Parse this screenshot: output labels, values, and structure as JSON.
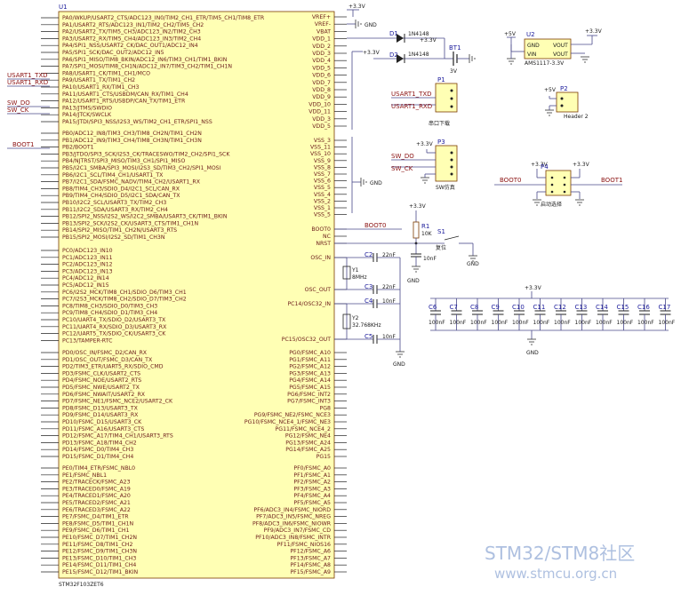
{
  "chip": {
    "designator": "U1",
    "part": "STM32F103ZET6",
    "left_group1": [
      "PA0/WKUP/USART2_CTS/ADC123_IN0/TIM2_CH1_ETR/TIM5_CH1/TIM8_ETR",
      "PA1/USART2_RTS/ADC123_IN1/TIM2_CH2/TIM5_CH2",
      "PA2/USART2_TX/TIM5_CH3/ADC123_IN2/TIM2_CH3",
      "PA3/USART2_RX/TIM5_CH4/ADC123_IN3/TIM2_CH4",
      "PA4/SPI1_NSS/USART2_CK/DAC_OUT1/ADC12_IN4",
      "PA5/SPI1_SCK/DAC_OUT2/ADC12_IN5",
      "PA6/SPI1_MISO/TIM8_BKIN/ADC12_IN6/TIM3_CH1/TIM1_BKIN",
      "PA7/SPI1_MOSI/TIM8_CH1N/ADC12_IN7/TIM3_CH2/TIM1_CH1N",
      "PA8/USART1_CK/TIM1_CH1/MCO",
      "PA9/USART1_TX/TIM1_CH2",
      "PA10/USART1_RX/TIM1_CH3",
      "PA11/USART1_CTS/USBDM/CAN_RX/TIM1_CH4",
      "PA12/USART1_RTS/USBDP/CAN_TX/TIM1_ETR",
      "PA13/JTMS/SWDIO",
      "PA14/JTCK/SWCLK",
      "PA15/JTDI/SPI3_NSS/I2S3_WS/TIM2_CH1_ETR/SPI1_NSS"
    ],
    "left_group2": [
      "PB0/ADC12_IN8/TIM3_CH3/TIM8_CH2N/TIM1_CH2N",
      "PB1/ADC12_IN9/TIM3_CH4/TIM8_CH3N/TIM1_CH3N",
      "PB2/BOOT1",
      "PB3/JTDO/SPI3_SCK/I2S3_CK/TRACESWO/TIM2_CH2/SPI1_SCK",
      "PB4/NJTRST/SPI3_MISO/TIM3_CH1/SPI1_MISO",
      "PB5/I2C1_SMBA/SPI3_MOSI/I2S3_SD/TIM3_CH2/SPI1_MOSI",
      "PB6/I2C1_SCL/TIM4_CH1/USART1_TX",
      "PB7/I2C1_SDA/FSMC_NADV/TIM4_CH2/USART1_RX",
      "PB8/TIM4_CH3/SDIO_D4/I2C1_SCL/CAN_RX",
      "PB9/TIM4_CH4/SDIO_D5/I2C1_SDA/CAN_TX",
      "PB10/I2C2_SCL/USART3_TX/TIM2_CH3",
      "PB11/I2C2_SDA/USART3_RX/TIM2_CH4",
      "PB12/SPI2_NSS/I2S2_WS/I2C2_SMBA/USART3_CK/TIM1_BKIN",
      "PB13/SPI2_SCK/I2S2_CK/USART3_CTS/TIM1_CH1N",
      "PB14/SPI2_MISO/TIM1_CH2N/USART3_RTS",
      "PB15/SPI2_MOSI/I2S2_SD/TIM1_CH3N"
    ],
    "left_group3": [
      "PC0/ADC123_IN10",
      "PC1/ADC123_IN11",
      "PC2/ADC123_IN12",
      "PC3/ADC123_IN13",
      "PC4/ADC12_IN14",
      "PC5/ADC12_IN15",
      "PC6/I2S2_MCK/TIM8_CH1/SDIO_D6/TIM3_CH1",
      "PC7/I2S3_MCK/TIM8_CH2/SDIO_D7/TIM3_CH2",
      "PC8/TIM8_CH3/SDIO_D0/TIM3_CH3",
      "PC9/TIM8_CH4/SDIO_D1/TIM3_CH4",
      "PC10/UART4_TX/SDIO_D2/USART3_TX",
      "PC11/UART4_RX/SDIO_D3/USART3_RX",
      "PC12/UART5_TX/SDIO_CK/USART3_CK",
      "PC13/TAMPER-RTC"
    ],
    "left_group4": [
      "PD0/OSC_IN/FSMC_D2/CAN_RX",
      "PD1/OSC_OUT/FSMC_D3/CAN_TX",
      "PD2/TIM3_ETR/UART5_RX/SDIO_CMD",
      "PD3/FSMC_CLK/USART2_CTS",
      "PD4/FSMC_NOE/USART2_RTS",
      "PD5/FSMC_NWE/USART2_TX",
      "PD6/FSMC_NWAIT/USART2_RX",
      "PD7/FSMC_NE1/FSMC_NCE2/USART2_CK",
      "PD8/FSMC_D13/USART3_TX",
      "PD9/FSMC_D14/USART3_RX",
      "PD10/FSMC_D15/USART3_CK",
      "PD11/FSMC_A16/USART3_CTS",
      "PD12/FSMC_A17/TIM4_CH1/USART3_RTS",
      "PD13/FSMC_A18/TIM4_CH2",
      "PD14/FSMC_D0/TIM4_CH3",
      "PD15/FSMC_D1/TIM4_CH4"
    ],
    "left_group5": [
      "PE0/TIM4_ETR/FSMC_NBL0",
      "PE1/FSMC_NBL1",
      "PE2/TRACECK/FSMC_A23",
      "PE3/TRACED0/FSMC_A19",
      "PE4/TRACED1/FSMC_A20",
      "PE5/TRACED2/FSMC_A21",
      "PE6/TRACED3/FSMC_A22",
      "PE7/FSMC_D4/TIM1_ETR",
      "PE8/FSMC_D5/TIM1_CH1N",
      "PE9/FSMC_D6/TIM1_CH1",
      "PE10/FSMC_D7/TIM1_CH2N",
      "PE11/FSMC_D8/TIM1_CH2",
      "PE12/FSMC_D9/TIM1_CH3N",
      "PE13/FSMC_D10/TIM1_CH3",
      "PE14/FSMC_D11/TIM1_CH4",
      "PE15/FSMC_D12/TIM1_BKIN"
    ],
    "right_power": [
      "VREF+",
      "VREF-",
      "VBAT",
      "VDD_1",
      "VDD_2",
      "VDD_3",
      "VDD_4",
      "VDD_5",
      "VDD_6",
      "VDD_7",
      "VDD_8",
      "VDD_9",
      "VDD_10",
      "VDD_11",
      "VDD_3",
      "VDD_5"
    ],
    "right_vss": [
      "VSS_3",
      "VSS_11",
      "VSS_10",
      "VSS_9",
      "VSS_8",
      "VSS_7",
      "VSS_6",
      "VSS_5",
      "VSS_4",
      "VSS_2",
      "VSS_1",
      "VSS_5"
    ],
    "right_ctrl": [
      "BOOT0",
      "NC",
      "NRST",
      "OSC_IN",
      "OSC_OUT",
      "PC14/OSC32_IN",
      "PC15/OSC32_OUT"
    ],
    "right_pg": [
      "PG0/FSMC_A10",
      "PG1/FSMC_A11",
      "PG2/FSMC_A12",
      "PG3/FSMC_A13",
      "PG4/FSMC_A14",
      "PG5/FSMC_A15",
      "PG6/FSMC_INT2",
      "PG7/FSMC_INT3",
      "PG8",
      "PG9/FSMC_NE2/FSMC_NCE3",
      "PG10/FSMC_NCE4_1/FSMC_NE3",
      "PG11/FSMC_NCE4_2",
      "PG12/FSMC_NE4",
      "PG13/FSMC_A24",
      "PG14/FSMC_A25",
      "PG15"
    ],
    "right_pf": [
      "PF0/FSMC_A0",
      "PF1/FSMC_A1",
      "PF2/FSMC_A2",
      "PF3/FSMC_A3",
      "PF4/FSMC_A4",
      "PF5/FSMC_A5",
      "PF6/ADC3_IN4/FSMC_NIORD",
      "PF7/ADC3_IN5/FSMC_NREG",
      "PF8/ADC3_IN6/FSMC_NIOWR",
      "PF9/ADC3_IN7/FSMC_CD",
      "PF10/ADC3_IN8/FSMC_INTR",
      "PF11/FSMC_NIOS16",
      "PF12/FSMC_A6",
      "PF13/FSMC_A7",
      "PF14/FSMC_A8",
      "PF15/FSMC_A9"
    ]
  },
  "nets": {
    "usart1_txd": "USART1_TXD",
    "usart1_rxd": "USART1_RXD",
    "sw_do": "SW_DO",
    "sw_ck": "SW_CK",
    "boot1": "BOOT1",
    "boot0": "BOOT0",
    "gnd": "GND",
    "v33": "+3.3V",
    "v5": "+5V"
  },
  "diodes": {
    "d1": "D1",
    "d2": "D2",
    "part": "1N4148"
  },
  "battery": {
    "designator": "BT1",
    "value": "3V"
  },
  "regulator": {
    "designator": "U2",
    "part": "AMS1117-3.3V",
    "pin_gnd": "GND",
    "pin_vout": "VOUT",
    "pin_vin": "VIN",
    "pin_vout2": "VOUT"
  },
  "header_p1": {
    "designator": "P1",
    "caption": "串口下载"
  },
  "header_p2": {
    "designator": "P2",
    "caption": "Header 2"
  },
  "header_p3": {
    "designator": "P3",
    "caption": "SW仿真"
  },
  "header_p4": {
    "designator": "P4",
    "caption": "启动选择"
  },
  "reset": {
    "r1": "R1",
    "r1_value": "10K",
    "s1": "S1",
    "s1_caption": "复位",
    "cap_value": "10nF"
  },
  "crystals": {
    "c2": "C2",
    "c3": "C3",
    "c4": "C4",
    "c5": "C5",
    "c22": "22nF",
    "c10": "10nF",
    "y1": "Y1",
    "y1_value": "8MHz",
    "y2": "Y2",
    "y2_value": "32.768KHz"
  },
  "decoupling": {
    "labels": [
      "C6",
      "C7",
      "C8",
      "C9",
      "C10",
      "C11",
      "C12",
      "C13",
      "C14",
      "C15",
      "C16",
      "C17"
    ],
    "value": "100nF"
  },
  "watermark": {
    "line1": "STM32/STM8社区",
    "line2": "www.stmcu.org.cn"
  }
}
